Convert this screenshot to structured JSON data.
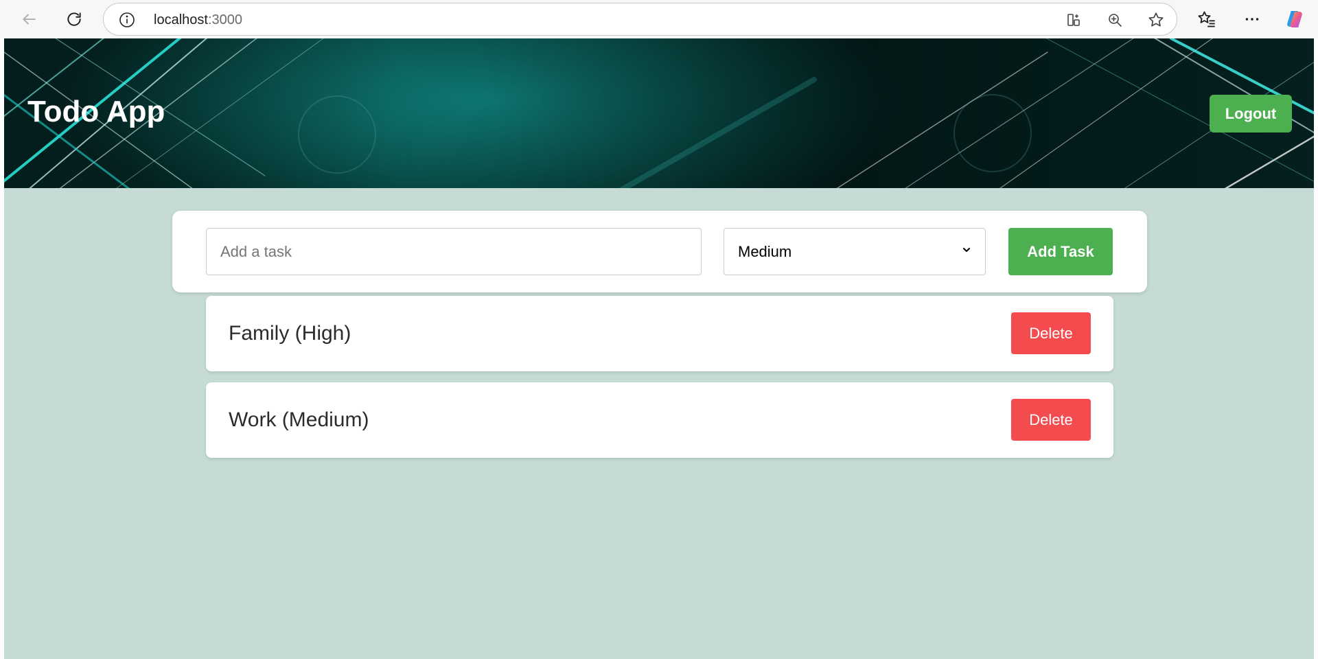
{
  "browser": {
    "url_host": "localhost",
    "url_port": ":3000",
    "icons": {
      "back": "back-arrow-icon",
      "reload": "reload-icon",
      "info": "info-icon",
      "split": "split-screen-icon",
      "zoom": "zoom-icon",
      "favorite": "star-icon",
      "favorites_list": "favorites-icon",
      "more": "more-icon",
      "copilot": "copilot-icon"
    }
  },
  "header": {
    "title": "Todo App",
    "logout_label": "Logout"
  },
  "add_form": {
    "placeholder": "Add a task",
    "priority_selected": "Medium",
    "add_label": "Add Task"
  },
  "tasks": [
    {
      "label": "Family (High)",
      "delete_label": "Delete"
    },
    {
      "label": "Work (Medium)",
      "delete_label": "Delete"
    }
  ],
  "colors": {
    "page_bg": "#c6dbd6",
    "primary_green": "#4caf50",
    "delete_red": "#f44b4f"
  }
}
